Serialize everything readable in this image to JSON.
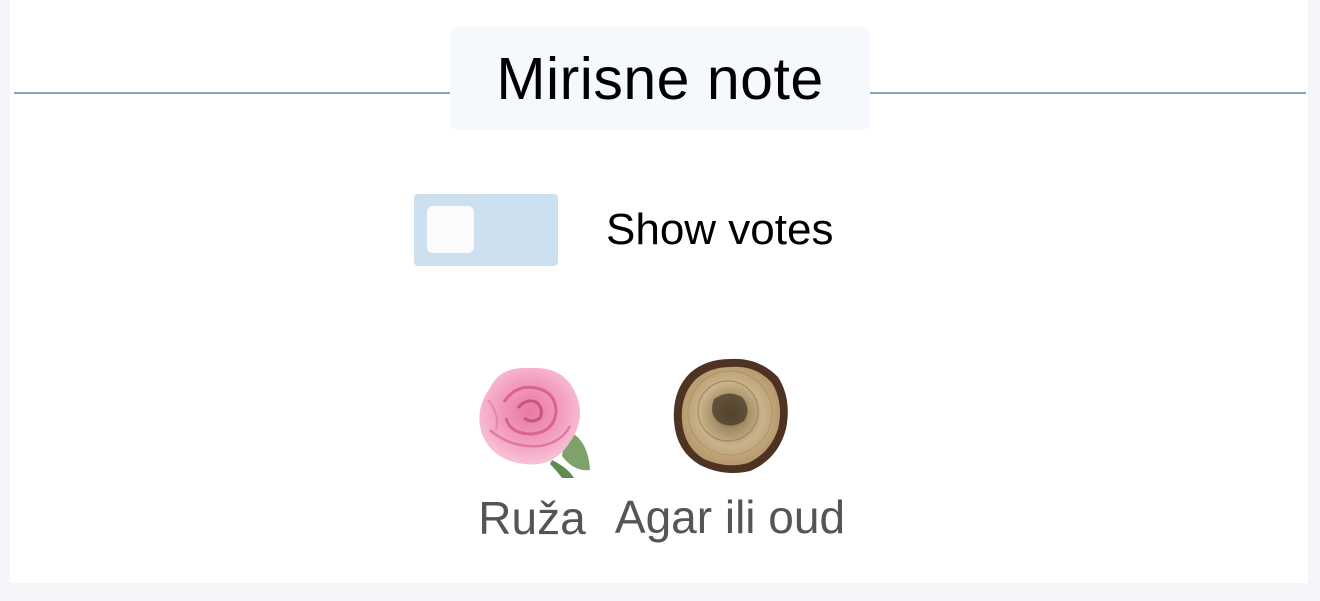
{
  "section": {
    "title": "Mirisne note"
  },
  "toggle": {
    "label": "Show votes",
    "on": false
  },
  "notes": [
    {
      "name": "Ruža",
      "icon": "rose-icon"
    },
    {
      "name": "Agar ili oud",
      "icon": "agarwood-icon"
    }
  ],
  "colors": {
    "rule": "#8aa4c0",
    "title_bg": "#f5f8fc",
    "toggle_bg": "#cde0f0",
    "note_text": "#555555"
  }
}
